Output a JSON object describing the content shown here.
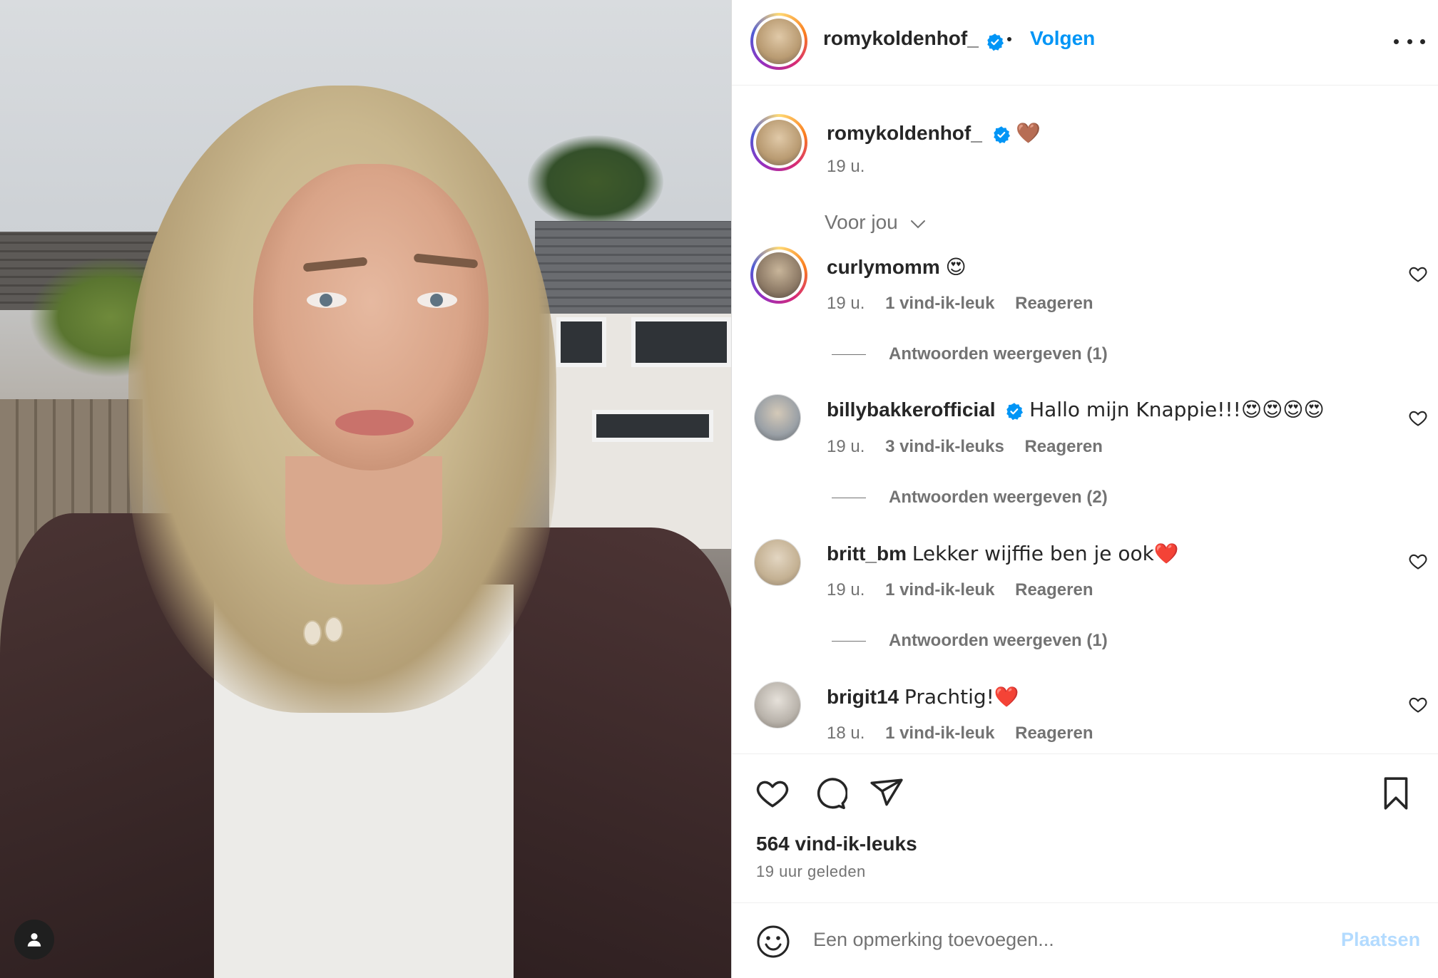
{
  "post_header": {
    "username": "romykoldenhof_",
    "follow_label": "Volgen",
    "more_icon": "more-options-icon"
  },
  "caption": {
    "username": "romykoldenhof_",
    "text": "🤎",
    "time": "19 u."
  },
  "filter": {
    "label": "Voor jou"
  },
  "comments": [
    {
      "username": "curlymomm",
      "text": "😍",
      "time": "19 u.",
      "likes": "1 vind-ik-leuk",
      "reply": "Reageren",
      "view_replies": "Antwoorden weergeven (1)"
    },
    {
      "username": "billybakkerofficial",
      "text": "Hallo mijn Knappie!!!😍😍😍😍",
      "time": "19 u.",
      "likes": "3 vind-ik-leuks",
      "reply": "Reageren",
      "view_replies": "Antwoorden weergeven (2)"
    },
    {
      "username": "britt_bm",
      "text": "Lekker wijffie ben je ook❤️",
      "time": "19 u.",
      "likes": "1 vind-ik-leuk",
      "reply": "Reageren",
      "view_replies": "Antwoorden weergeven (1)"
    },
    {
      "username": "brigit14",
      "text": "Prachtig!❤️",
      "time": "18 u.",
      "likes": "1 vind-ik-leuk",
      "reply": "Reageren"
    }
  ],
  "stats": {
    "likes": "564 vind-ik-leuks",
    "posted_ago": "19 uur geleden"
  },
  "composer": {
    "placeholder": "Een opmerking toevoegen...",
    "post_label": "Plaatsen"
  },
  "colors": {
    "accent": "#0095f6",
    "verified": "#0095f6",
    "muted_text": "#737373",
    "post_disabled": "#b3dbff"
  }
}
